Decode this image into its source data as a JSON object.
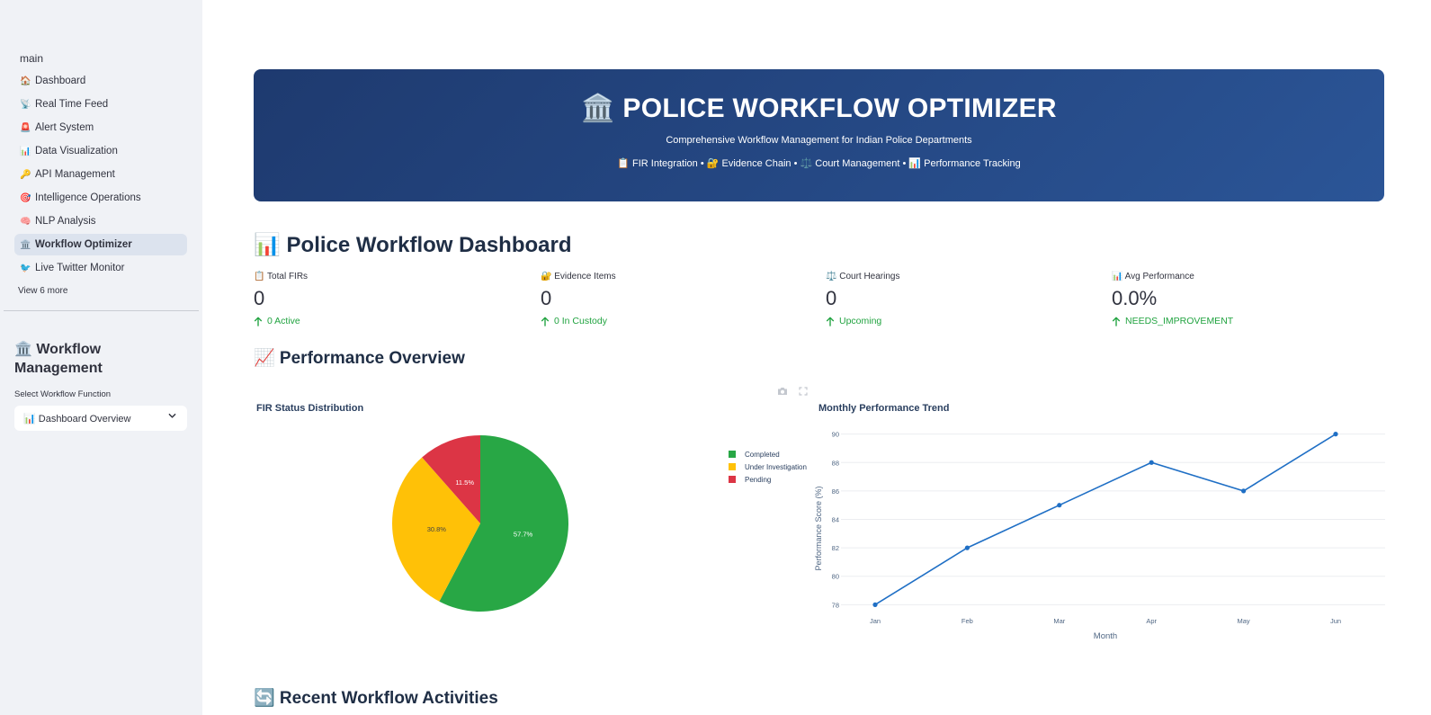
{
  "sidebar": {
    "section_label": "main",
    "items": [
      {
        "icon": "🏠",
        "label": "Dashboard",
        "icon_name": "house-icon"
      },
      {
        "icon": "📡",
        "label": "Real Time Feed",
        "icon_name": "satellite-icon"
      },
      {
        "icon": "🚨",
        "label": "Alert System",
        "icon_name": "siren-icon"
      },
      {
        "icon": "📊",
        "label": "Data Visualization",
        "icon_name": "bar-chart-icon"
      },
      {
        "icon": "🔑",
        "label": "API Management",
        "icon_name": "key-icon"
      },
      {
        "icon": "🎯",
        "label": "Intelligence Operations",
        "icon_name": "target-icon"
      },
      {
        "icon": "🧠",
        "label": "NLP Analysis",
        "icon_name": "brain-icon"
      },
      {
        "icon": "🏛️",
        "label": "Workflow Optimizer",
        "icon_name": "building-icon",
        "active": true
      },
      {
        "icon": "🐦",
        "label": "Live Twitter Monitor",
        "icon_name": "bird-icon"
      }
    ],
    "view_more": "View 6 more",
    "workflow_title": "🏛️ Workflow Management",
    "select_label": "Select Workflow Function",
    "select_value": "📊 Dashboard Overview"
  },
  "hero": {
    "title": "🏛️ POLICE WORKFLOW OPTIMIZER",
    "subtitle": "Comprehensive Workflow Management for Indian Police Departments",
    "features": "📋 FIR Integration • 🔐 Evidence Chain • ⚖️ Court Management • 📊 Performance Tracking"
  },
  "dashboard": {
    "heading": "📊 Police Workflow Dashboard",
    "metrics": [
      {
        "label": "📋 Total FIRs",
        "value": "0",
        "delta": "0 Active"
      },
      {
        "label": "🔐 Evidence Items",
        "value": "0",
        "delta": "0 In Custody"
      },
      {
        "label": "⚖️ Court Hearings",
        "value": "0",
        "delta": "Upcoming"
      },
      {
        "label": "📊 Avg Performance",
        "value": "0.0%",
        "delta": "NEEDS_IMPROVEMENT"
      }
    ],
    "performance_heading": "📈 Performance Overview",
    "recent_heading": "🔄 Recent Workflow Activities"
  },
  "colors": {
    "completed": "#28a745",
    "under_investigation": "#ffc107",
    "pending": "#dc3545",
    "line": "#1f6fc5",
    "positive_delta": "#21a340"
  },
  "chart_data": [
    {
      "type": "pie",
      "title": "FIR Status Distribution",
      "labels": [
        "Completed",
        "Under Investigation",
        "Pending"
      ],
      "values": [
        57.7,
        30.8,
        11.5
      ],
      "text_labels": [
        "57.7%",
        "30.8%",
        "11.5%"
      ],
      "legend_position": "top-right"
    },
    {
      "type": "line",
      "title": "Monthly Performance Trend",
      "x": [
        "Jan",
        "Feb",
        "Mar",
        "Apr",
        "May",
        "Jun"
      ],
      "y": [
        78,
        82,
        85,
        88,
        86,
        90
      ],
      "xlabel": "Month",
      "ylabel": "Performance Score (%)",
      "yticks": [
        78,
        80,
        82,
        84,
        86,
        88,
        90
      ],
      "ylim": [
        77.2,
        90.8
      ],
      "grid": true
    }
  ]
}
